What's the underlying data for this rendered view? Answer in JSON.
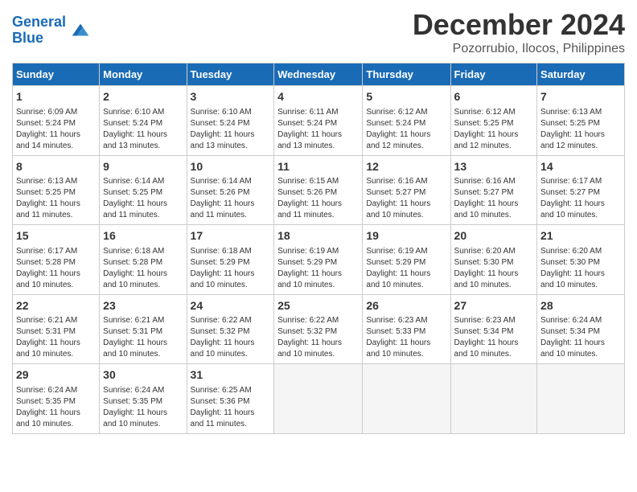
{
  "header": {
    "logo_line1": "General",
    "logo_line2": "Blue",
    "month": "December 2024",
    "location": "Pozorrubio, Ilocos, Philippines"
  },
  "days_of_week": [
    "Sunday",
    "Monday",
    "Tuesday",
    "Wednesday",
    "Thursday",
    "Friday",
    "Saturday"
  ],
  "weeks": [
    [
      {
        "day": "1",
        "info": "Sunrise: 6:09 AM\nSunset: 5:24 PM\nDaylight: 11 hours\nand 14 minutes."
      },
      {
        "day": "2",
        "info": "Sunrise: 6:10 AM\nSunset: 5:24 PM\nDaylight: 11 hours\nand 13 minutes."
      },
      {
        "day": "3",
        "info": "Sunrise: 6:10 AM\nSunset: 5:24 PM\nDaylight: 11 hours\nand 13 minutes."
      },
      {
        "day": "4",
        "info": "Sunrise: 6:11 AM\nSunset: 5:24 PM\nDaylight: 11 hours\nand 13 minutes."
      },
      {
        "day": "5",
        "info": "Sunrise: 6:12 AM\nSunset: 5:24 PM\nDaylight: 11 hours\nand 12 minutes."
      },
      {
        "day": "6",
        "info": "Sunrise: 6:12 AM\nSunset: 5:25 PM\nDaylight: 11 hours\nand 12 minutes."
      },
      {
        "day": "7",
        "info": "Sunrise: 6:13 AM\nSunset: 5:25 PM\nDaylight: 11 hours\nand 12 minutes."
      }
    ],
    [
      {
        "day": "8",
        "info": "Sunrise: 6:13 AM\nSunset: 5:25 PM\nDaylight: 11 hours\nand 11 minutes."
      },
      {
        "day": "9",
        "info": "Sunrise: 6:14 AM\nSunset: 5:25 PM\nDaylight: 11 hours\nand 11 minutes."
      },
      {
        "day": "10",
        "info": "Sunrise: 6:14 AM\nSunset: 5:26 PM\nDaylight: 11 hours\nand 11 minutes."
      },
      {
        "day": "11",
        "info": "Sunrise: 6:15 AM\nSunset: 5:26 PM\nDaylight: 11 hours\nand 11 minutes."
      },
      {
        "day": "12",
        "info": "Sunrise: 6:16 AM\nSunset: 5:27 PM\nDaylight: 11 hours\nand 10 minutes."
      },
      {
        "day": "13",
        "info": "Sunrise: 6:16 AM\nSunset: 5:27 PM\nDaylight: 11 hours\nand 10 minutes."
      },
      {
        "day": "14",
        "info": "Sunrise: 6:17 AM\nSunset: 5:27 PM\nDaylight: 11 hours\nand 10 minutes."
      }
    ],
    [
      {
        "day": "15",
        "info": "Sunrise: 6:17 AM\nSunset: 5:28 PM\nDaylight: 11 hours\nand 10 minutes."
      },
      {
        "day": "16",
        "info": "Sunrise: 6:18 AM\nSunset: 5:28 PM\nDaylight: 11 hours\nand 10 minutes."
      },
      {
        "day": "17",
        "info": "Sunrise: 6:18 AM\nSunset: 5:29 PM\nDaylight: 11 hours\nand 10 minutes."
      },
      {
        "day": "18",
        "info": "Sunrise: 6:19 AM\nSunset: 5:29 PM\nDaylight: 11 hours\nand 10 minutes."
      },
      {
        "day": "19",
        "info": "Sunrise: 6:19 AM\nSunset: 5:29 PM\nDaylight: 11 hours\nand 10 minutes."
      },
      {
        "day": "20",
        "info": "Sunrise: 6:20 AM\nSunset: 5:30 PM\nDaylight: 11 hours\nand 10 minutes."
      },
      {
        "day": "21",
        "info": "Sunrise: 6:20 AM\nSunset: 5:30 PM\nDaylight: 11 hours\nand 10 minutes."
      }
    ],
    [
      {
        "day": "22",
        "info": "Sunrise: 6:21 AM\nSunset: 5:31 PM\nDaylight: 11 hours\nand 10 minutes."
      },
      {
        "day": "23",
        "info": "Sunrise: 6:21 AM\nSunset: 5:31 PM\nDaylight: 11 hours\nand 10 minutes."
      },
      {
        "day": "24",
        "info": "Sunrise: 6:22 AM\nSunset: 5:32 PM\nDaylight: 11 hours\nand 10 minutes."
      },
      {
        "day": "25",
        "info": "Sunrise: 6:22 AM\nSunset: 5:32 PM\nDaylight: 11 hours\nand 10 minutes."
      },
      {
        "day": "26",
        "info": "Sunrise: 6:23 AM\nSunset: 5:33 PM\nDaylight: 11 hours\nand 10 minutes."
      },
      {
        "day": "27",
        "info": "Sunrise: 6:23 AM\nSunset: 5:34 PM\nDaylight: 11 hours\nand 10 minutes."
      },
      {
        "day": "28",
        "info": "Sunrise: 6:24 AM\nSunset: 5:34 PM\nDaylight: 11 hours\nand 10 minutes."
      }
    ],
    [
      {
        "day": "29",
        "info": "Sunrise: 6:24 AM\nSunset: 5:35 PM\nDaylight: 11 hours\nand 10 minutes."
      },
      {
        "day": "30",
        "info": "Sunrise: 6:24 AM\nSunset: 5:35 PM\nDaylight: 11 hours\nand 10 minutes."
      },
      {
        "day": "31",
        "info": "Sunrise: 6:25 AM\nSunset: 5:36 PM\nDaylight: 11 hours\nand 11 minutes."
      },
      {
        "day": "",
        "info": ""
      },
      {
        "day": "",
        "info": ""
      },
      {
        "day": "",
        "info": ""
      },
      {
        "day": "",
        "info": ""
      }
    ]
  ]
}
